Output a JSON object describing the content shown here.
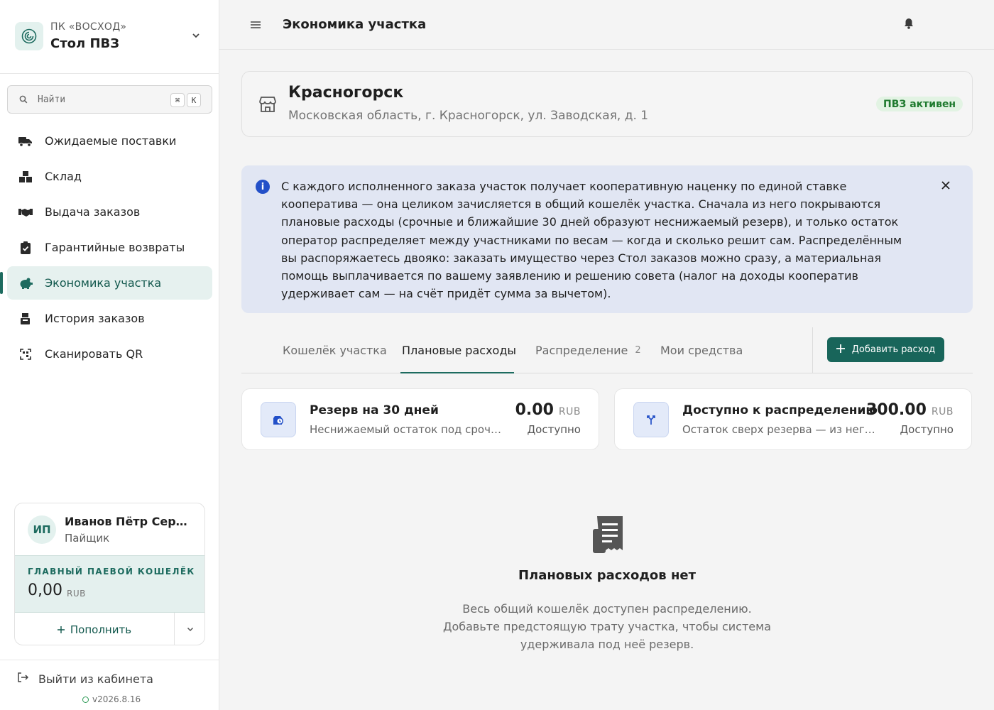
{
  "colors": {
    "accent": "#1d6b5f",
    "accent_bg": "#e6f1ef",
    "info_bg": "#e1e6f3",
    "info_icon": "#2350c8",
    "badge_bg": "#e2f3e3",
    "badge_text": "#1e7a2e"
  },
  "org": {
    "logo_icon": "spiral-logo",
    "subtitle": "ПК «ВОСХОД»",
    "name": "Стол ПВЗ"
  },
  "search": {
    "placeholder": "Найти",
    "shortcut_1": "⌘",
    "shortcut_2": "K"
  },
  "sidebar": {
    "items": [
      {
        "label": "Ожидаемые поставки",
        "icon": "truck-icon"
      },
      {
        "label": "Склад",
        "icon": "boxes-icon"
      },
      {
        "label": "Выдача заказов",
        "icon": "handshake-icon"
      },
      {
        "label": "Гарантийные возвраты",
        "icon": "clipboard-check-icon"
      },
      {
        "label": "Экономика участка",
        "icon": "piggy-bank-icon",
        "active": true
      },
      {
        "label": "История заказов",
        "icon": "cash-register-icon"
      },
      {
        "label": "Сканировать QR",
        "icon": "qr-scan-icon"
      }
    ]
  },
  "user": {
    "initials": "ИП",
    "name": "Иванов Пётр Сергеевич",
    "role": "Пайщик",
    "wallet_title": "ГЛАВНЫЙ ПАЕВОЙ КОШЕЛЁК",
    "wallet_amount": "0,00",
    "wallet_currency": "RUB",
    "topup_label": "Пополнить"
  },
  "footer": {
    "logout_label": "Выйти из кабинета",
    "version": "v2026.8.16"
  },
  "header": {
    "title": "Экономика участка"
  },
  "location": {
    "name": "Красногорск",
    "address": "Московская область, г. Красногорск, ул. Заводская, д. 1",
    "status": "ПВЗ активен"
  },
  "info": {
    "text": "С каждого исполненного заказа участок получает кооперативную наценку по единой ставке кооператива — она целиком зачисляется в общий кошелёк участка. Сначала из него покрываются плановые расходы (срочные и ближайшие 30 дней образуют неснижаемый резерв), и только остаток оператор распределяет между участниками по весам — когда и сколько решит сам. Распределённым вы распоряжаетесь двояко: заказать имущество через Стол заказов можно сразу, а материальная помощь выплачивается по вашему заявлению и решению совета (налог на доходы кооператив удерживает сам — на счёт придёт сумма за вычетом)."
  },
  "tabs": {
    "items": [
      {
        "label": "Кошелёк участка"
      },
      {
        "label": "Плановые расходы",
        "active": true
      },
      {
        "label": "Распределение",
        "count": "2"
      },
      {
        "label": "Мои средства"
      }
    ],
    "add_button": "Добавить расход"
  },
  "stats": [
    {
      "icon": "clock-bag-icon",
      "title": "Резерв на 30 дней",
      "description": "Неснижаемый остаток под срочные и ближайшие расходы",
      "value": "0.00",
      "currency": "RUB",
      "status": "Доступно"
    },
    {
      "icon": "split-arrows-icon",
      "title": "Доступно к распределению",
      "description": "Остаток сверх резерва — из него распределяются средства",
      "value": "300.00",
      "currency": "RUB",
      "status": "Доступно"
    }
  ],
  "empty": {
    "icon": "receipt-icon",
    "title": "Плановых расходов нет",
    "text": "Весь общий кошелёк доступен распределению. Добавьте предстоящую трату участка, чтобы система удерживала под неё резерв."
  }
}
